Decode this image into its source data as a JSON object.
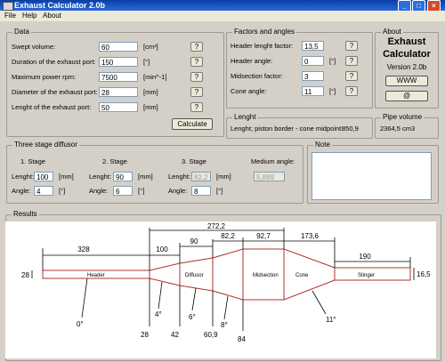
{
  "window": {
    "title": "Exhaust Calculator 2.0b"
  },
  "menu": [
    "File",
    "Help",
    "About"
  ],
  "data_group": {
    "title": "Data",
    "rows": [
      {
        "label": "Swept volume:",
        "value": "60",
        "unit": "[cm³]"
      },
      {
        "label": "Duration of the exhaust port:",
        "value": "150",
        "unit": "[°]"
      },
      {
        "label": "Maximum power rpm:",
        "value": "7500",
        "unit": "[min^-1]"
      },
      {
        "label": "Diameter of the exhaust port:",
        "value": "28",
        "unit": "[mm]"
      },
      {
        "label": "Lenght of the exhaust port:",
        "value": "50",
        "unit": "[mm]"
      }
    ],
    "help_label": "?",
    "calculate_label": "Calculate"
  },
  "factors_group": {
    "title": "Factors and angles",
    "rows": [
      {
        "label": "Header lenght factor:",
        "value": "13,5",
        "unit": ""
      },
      {
        "label": "Header angle:",
        "value": "0",
        "unit": "[°]"
      },
      {
        "label": "Midsection factor:",
        "value": "3",
        "unit": ""
      },
      {
        "label": "Cone angle:",
        "value": "11",
        "unit": "[°]"
      }
    ]
  },
  "about_group": {
    "title": "About",
    "app_name_line1": "Exhaust",
    "app_name_line2": "Calculator",
    "version": "Version 2.0b",
    "www_label": "WWW",
    "at_label": "@"
  },
  "lenght_group": {
    "title": "Lenght",
    "text": "Lenght; piston border - cone midpoint:",
    "value": "850,9"
  },
  "pipe_volume_group": {
    "title": "Pipe volume",
    "value": "2364,5 cm3"
  },
  "diffuser_group": {
    "title": "Three stage diffusor",
    "stages": [
      {
        "title": "1. Stage",
        "lenght_label": "Lenght:",
        "lenght": "100",
        "lenght_unit": "[mm]",
        "angle_label": "Angle:",
        "angle": "4",
        "angle_unit": "[°]"
      },
      {
        "title": "2. Stage",
        "lenght_label": "Lenght:",
        "lenght": "90",
        "lenght_unit": "[mm]",
        "angle_label": "Angle:",
        "angle": "6",
        "angle_unit": "[°]"
      },
      {
        "title": "3. Stage",
        "lenght_label": "Lenght:",
        "lenght": "82,2",
        "lenght_unit": "[mm]",
        "angle_label": "Angle:",
        "angle": "8",
        "angle_unit": "[°]"
      }
    ],
    "medium_angle_label": "Medium angle:",
    "medium_angle": "5,889"
  },
  "note_group": {
    "title": "Note",
    "text": ""
  },
  "results": {
    "title": "Results",
    "segments": [
      "Header",
      "Diffusor",
      "Midsection",
      "Cone",
      "Stinger"
    ],
    "dims_top": [
      "328",
      "272,2",
      "100",
      "90",
      "82,2",
      "92,7",
      "173,6",
      "190"
    ],
    "dims_side": [
      "28",
      "16,5"
    ],
    "diameters_bottom": [
      "28",
      "42",
      "60,9",
      "84"
    ],
    "angles": [
      "0°",
      "4°",
      "6°",
      "8°",
      "11°"
    ]
  }
}
